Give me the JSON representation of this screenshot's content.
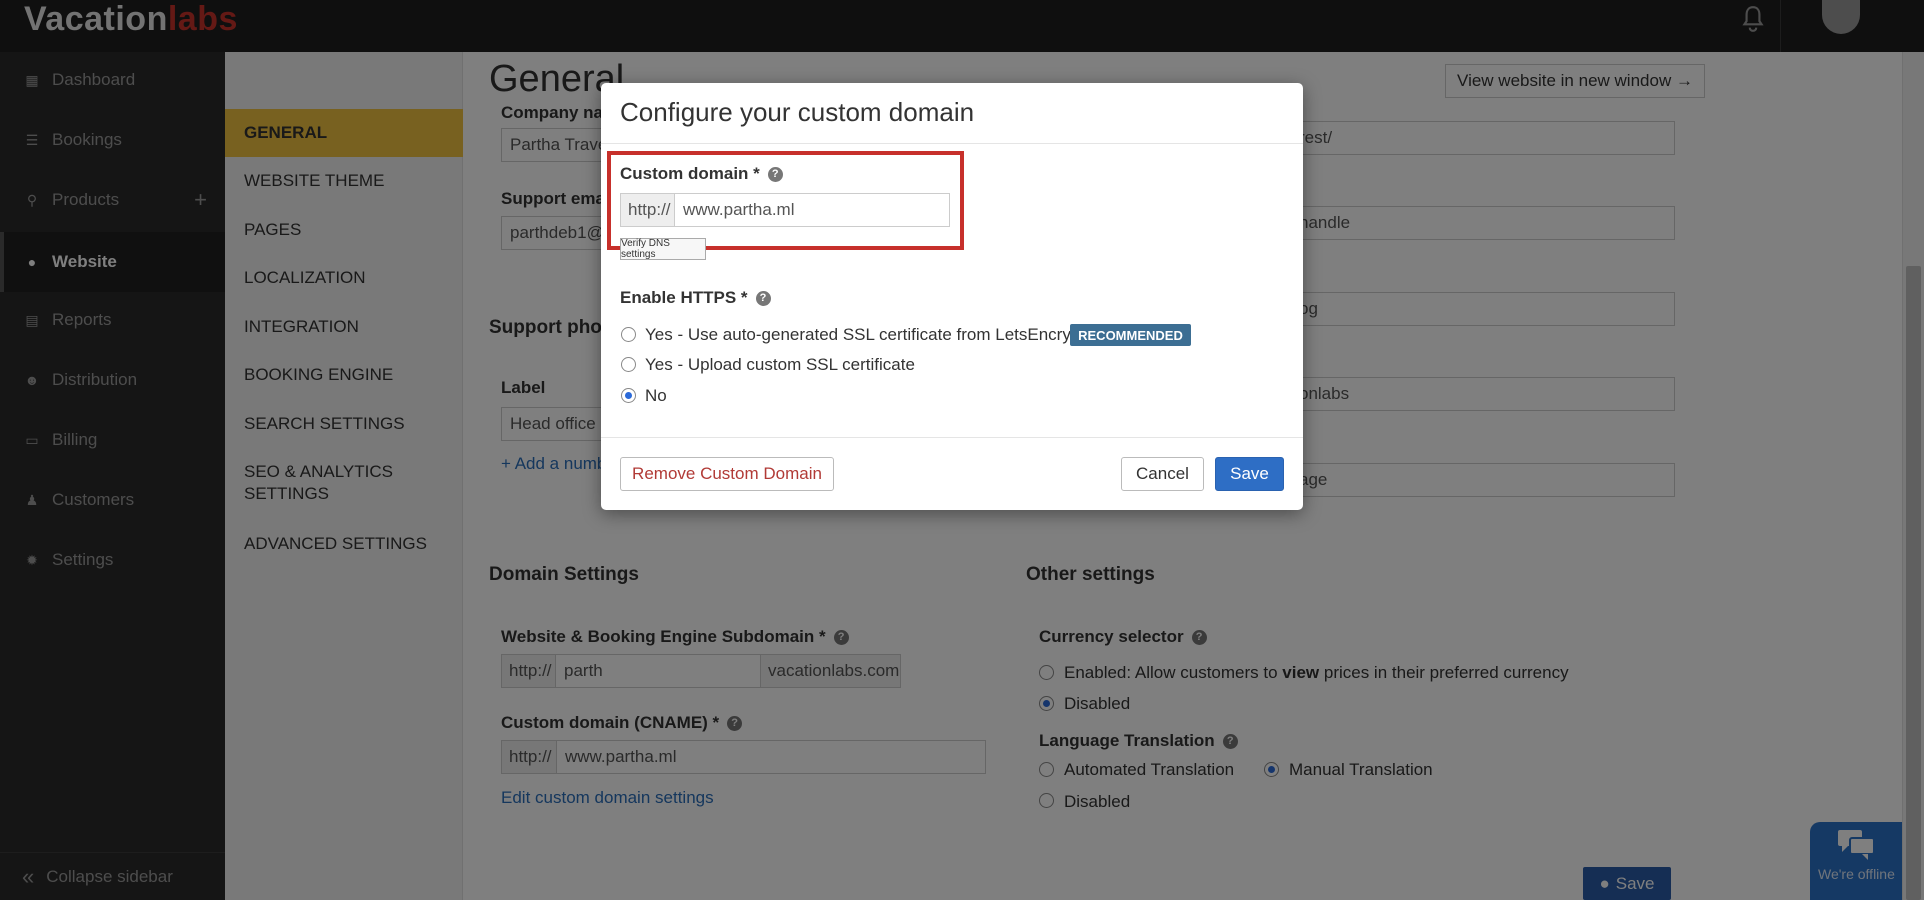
{
  "app": {
    "logo_part1": "Vacation",
    "logo_part2": "labs"
  },
  "sidebar": {
    "items": [
      {
        "label": "Dashboard",
        "icon": "calendar-icon"
      },
      {
        "label": "Bookings",
        "icon": "list-icon"
      },
      {
        "label": "Products",
        "icon": "map-pin-icon"
      },
      {
        "label": "Website",
        "icon": "globe-icon"
      },
      {
        "label": "Reports",
        "icon": "document-icon"
      },
      {
        "label": "Distribution",
        "icon": "users-icon"
      },
      {
        "label": "Billing",
        "icon": "money-icon"
      },
      {
        "label": "Customers",
        "icon": "user-icon"
      },
      {
        "label": "Settings",
        "icon": "gear-icon"
      }
    ],
    "add_symbol": "+",
    "collapse_label": "Collapse sidebar"
  },
  "subnav": {
    "items": [
      "GENERAL",
      "WEBSITE THEME",
      "PAGES",
      "LOCALIZATION",
      "INTEGRATION",
      "BOOKING ENGINE",
      "SEARCH SETTINGS",
      "SEO & ANALYTICS SETTINGS",
      "ADVANCED SETTINGS"
    ]
  },
  "main": {
    "title": "General",
    "view_website": "View website in new window →",
    "company_name_label": "Company na",
    "company_name_value": "Partha Trave",
    "support_email_label": "Support ema",
    "support_email_value": "parthdeb1@",
    "support_phone_label": "Support phon",
    "phone_label_header": "Label",
    "phone_label_placeholder": "Head office",
    "add_number": "+ Add a numb",
    "right_fields": [
      "rest/",
      "handle",
      "og",
      "onlabs",
      "age"
    ],
    "domain_settings": {
      "heading": "Domain Settings",
      "subdomain_label": "Website & Booking Engine Subdomain *",
      "subdomain_prefix": "http://",
      "subdomain_value": "parth",
      "subdomain_suffix": "vacationlabs.com",
      "cname_label": "Custom domain (CNAME) *",
      "cname_prefix": "http://",
      "cname_value": "www.partha.ml",
      "edit_link": "Edit custom domain settings"
    },
    "other_settings": {
      "heading": "Other settings",
      "currency_label": "Currency selector",
      "currency_enabled_pre": "Enabled: Allow customers to ",
      "currency_enabled_bold": "view",
      "currency_enabled_post": " prices in their preferred currency",
      "currency_disabled": "Disabled",
      "language_label": "Language Translation",
      "lang_automated": "Automated Translation",
      "lang_manual": "Manual Translation",
      "lang_disabled": "Disabled"
    },
    "save_button": "Save"
  },
  "chat": {
    "status": "We're offline"
  },
  "modal": {
    "title": "Configure your custom domain",
    "custom_domain_label": "Custom domain *",
    "prefix": "http://",
    "domain_value": "www.partha.ml",
    "verify_button": "Verify DNS settings",
    "https_label": "Enable HTTPS *",
    "options": [
      {
        "label": "Yes - Use auto-generated SSL certificate from LetsEncrypt",
        "checked": false
      },
      {
        "label": "Yes - Upload custom SSL certificate",
        "checked": false
      },
      {
        "label": "No",
        "checked": true
      }
    ],
    "badge": "RECOMMENDED",
    "remove_button": "Remove Custom Domain",
    "cancel_button": "Cancel",
    "save_button": "Save"
  },
  "colors": {
    "accent_yellow": "#f0c340",
    "primary_blue": "#2e6ec5",
    "highlight_red": "#c7302b",
    "badge_blue": "#3c6e93"
  }
}
